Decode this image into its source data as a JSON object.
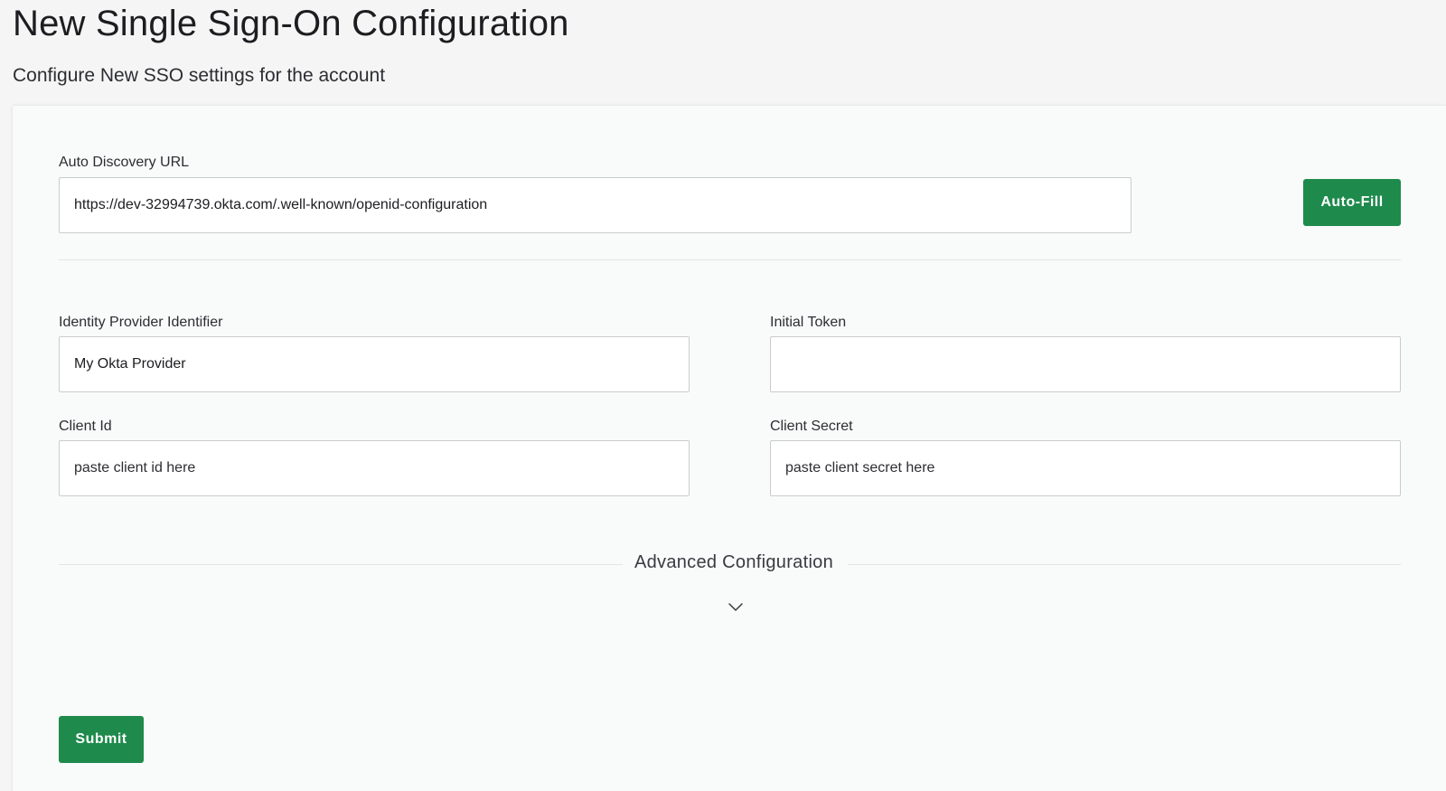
{
  "header": {
    "title": "New Single Sign-On Configuration",
    "subtitle": "Configure New SSO settings for the account"
  },
  "form": {
    "discovery": {
      "label": "Auto Discovery URL",
      "value": "https://dev-32994739.okta.com/.well-known/openid-configuration",
      "button_label": "Auto-Fill"
    },
    "idp_identifier": {
      "label": "Identity Provider Identifier",
      "value": "My Okta Provider"
    },
    "initial_token": {
      "label": "Initial Token",
      "value": ""
    },
    "client_id": {
      "label": "Client Id",
      "placeholder": "paste client id here"
    },
    "client_secret": {
      "label": "Client Secret",
      "placeholder": "paste client secret here"
    },
    "advanced": {
      "label": "Advanced Configuration",
      "icon": "chevron-down-icon"
    },
    "submit_label": "Submit"
  },
  "colors": {
    "accent": "#1e8a4c",
    "page_background": "#f4f5f4",
    "panel_background": "#f9fafa"
  }
}
